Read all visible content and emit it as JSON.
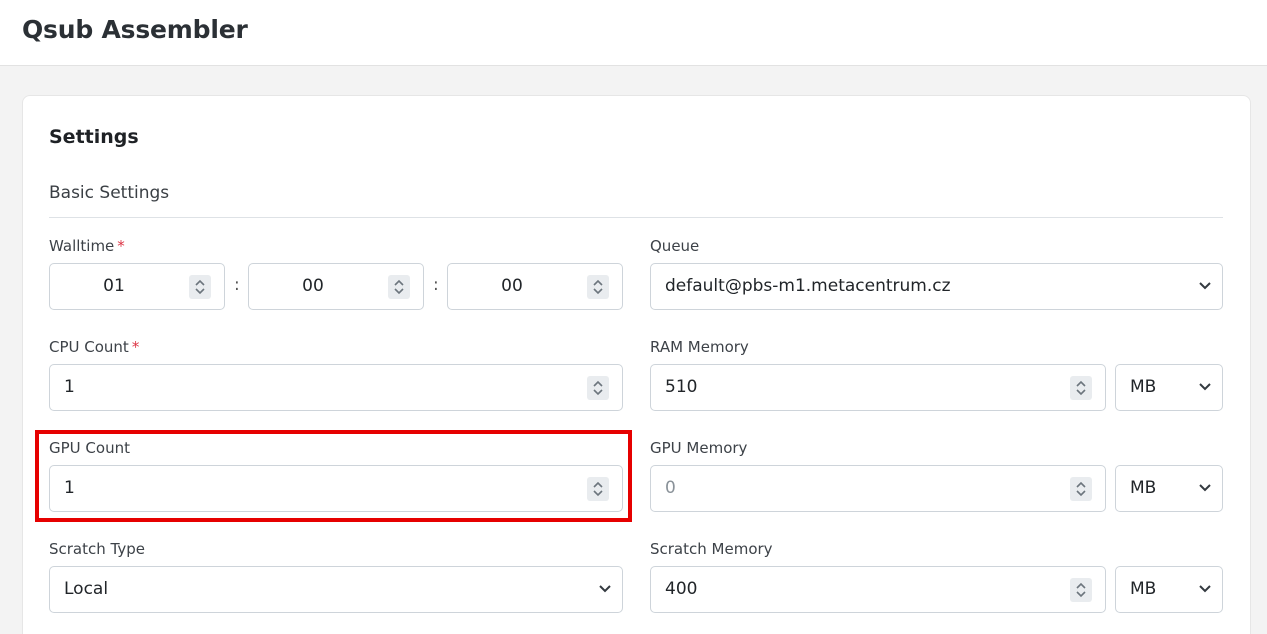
{
  "header": {
    "title": "Qsub Assembler"
  },
  "settings": {
    "title": "Settings",
    "section": "Basic Settings",
    "walltime": {
      "label": "Walltime",
      "required": "*",
      "hours": "01",
      "minutes": "00",
      "seconds": "00",
      "separator": ":"
    },
    "queue": {
      "label": "Queue",
      "value": "default@pbs-m1.metacentrum.cz"
    },
    "cpu_count": {
      "label": "CPU Count",
      "required": "*",
      "value": "1"
    },
    "ram_memory": {
      "label": "RAM Memory",
      "value": "510",
      "unit": "MB"
    },
    "gpu_count": {
      "label": "GPU Count",
      "value": "1"
    },
    "gpu_memory": {
      "label": "GPU Memory",
      "placeholder": "0",
      "unit": "MB"
    },
    "scratch_type": {
      "label": "Scratch Type",
      "value": "Local"
    },
    "scratch_memory": {
      "label": "Scratch Memory",
      "value": "400",
      "unit": "MB"
    }
  },
  "annotation": {
    "highlight_color": "#e60000"
  }
}
